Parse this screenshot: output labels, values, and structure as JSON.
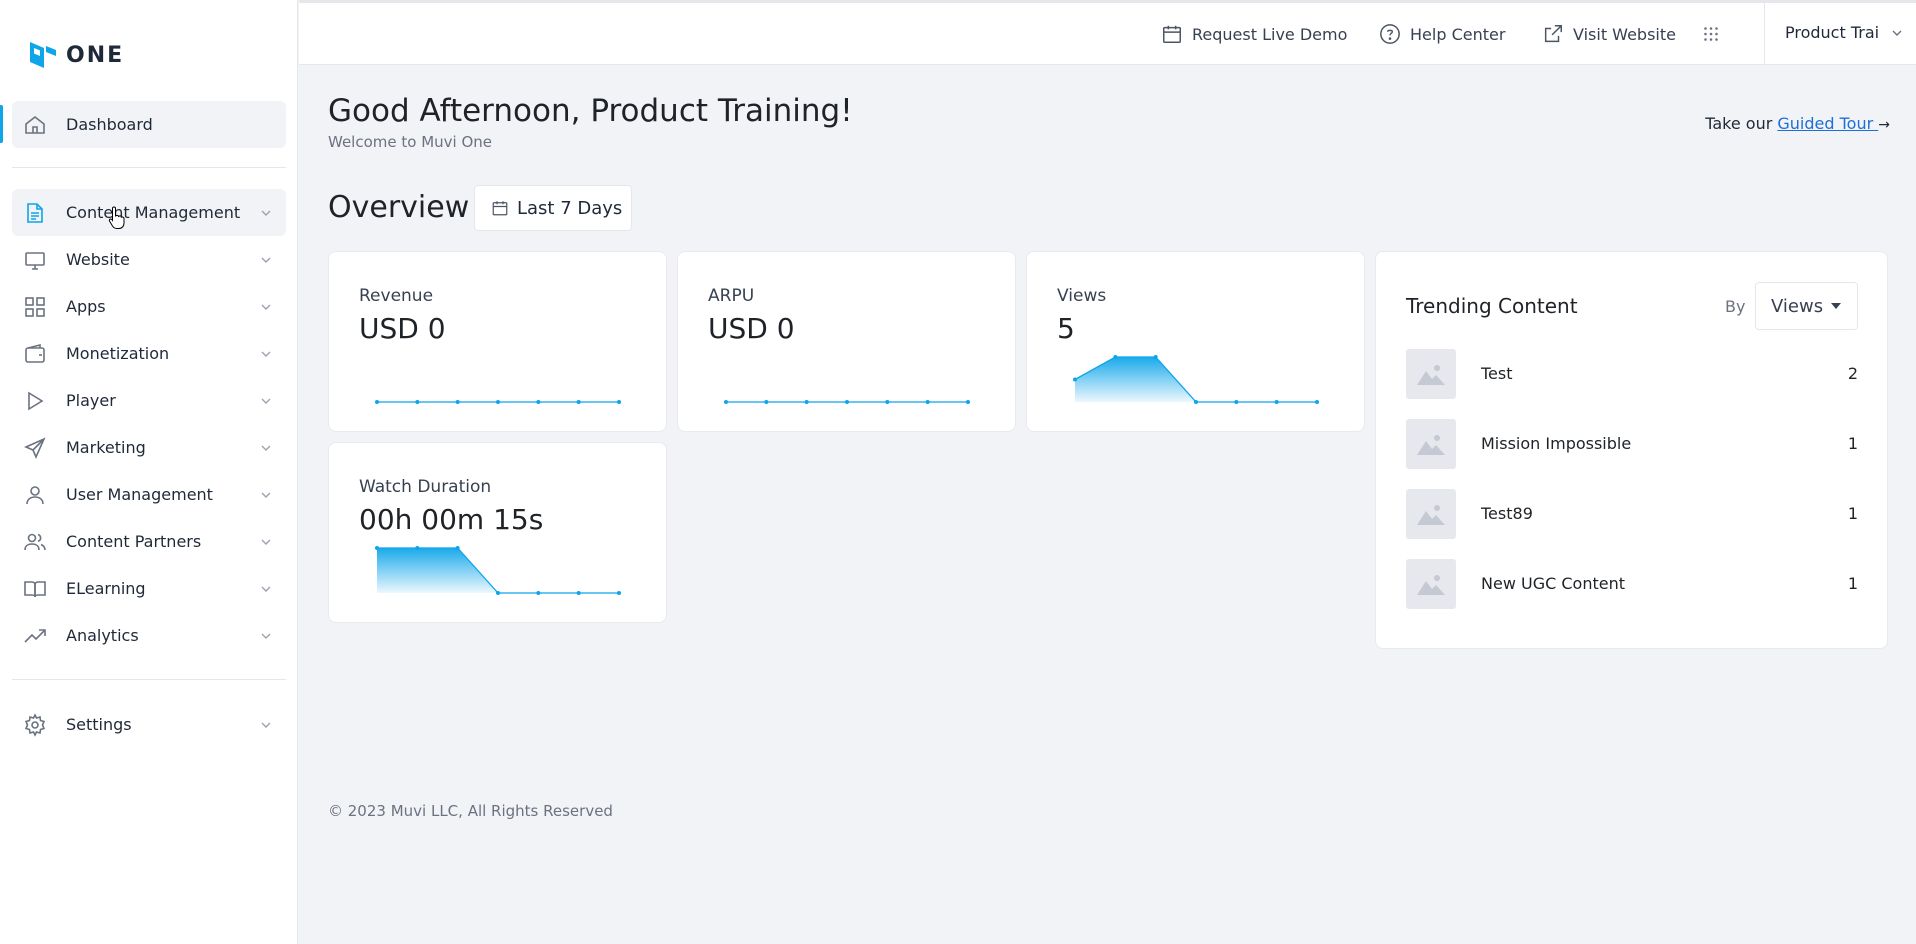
{
  "app": {
    "logo_text": "ONE",
    "brand_color": "#0ea5e9"
  },
  "sidebar": {
    "dashboard": {
      "label": "Dashboard",
      "icon": "home-icon"
    },
    "items": [
      {
        "label": "Content Management",
        "icon": "document-icon"
      },
      {
        "label": "Website",
        "icon": "monitor-icon"
      },
      {
        "label": "Apps",
        "icon": "grid-icon"
      },
      {
        "label": "Monetization",
        "icon": "wallet-icon"
      },
      {
        "label": "Player",
        "icon": "play-icon"
      },
      {
        "label": "Marketing",
        "icon": "send-icon"
      },
      {
        "label": "User Management",
        "icon": "user-icon"
      },
      {
        "label": "Content Partners",
        "icon": "users-icon"
      },
      {
        "label": "ELearning",
        "icon": "book-icon"
      },
      {
        "label": "Analytics",
        "icon": "trending-up-icon"
      }
    ],
    "settings": {
      "label": "Settings",
      "icon": "gear-icon"
    }
  },
  "topbar": {
    "request_demo": "Request Live Demo",
    "help_center": "Help Center",
    "visit_website": "Visit Website",
    "account": "Product Trai"
  },
  "header": {
    "greeting": "Good Afternoon, Product Training!",
    "welcome": "Welcome to Muvi One",
    "tour_prefix": "Take our ",
    "tour_link": "Guided Tour "
  },
  "overview": {
    "title": "Overview",
    "range": "Last 7 Days",
    "cards": [
      {
        "title": "Revenue",
        "value": "USD 0",
        "series": [
          0,
          0,
          0,
          0,
          0,
          0,
          0
        ]
      },
      {
        "title": "ARPU",
        "value": "USD 0",
        "series": [
          0,
          0,
          0,
          0,
          0,
          0,
          0
        ]
      },
      {
        "title": "Views",
        "value": "5",
        "series": [
          1,
          2,
          2,
          0,
          0,
          0,
          0
        ]
      },
      {
        "title": "Watch Duration",
        "value": "00h 00m 15s",
        "series": [
          5,
          5,
          5,
          0,
          0,
          0,
          0
        ]
      }
    ]
  },
  "trending": {
    "title": "Trending Content",
    "by_label": "By",
    "metric": "Views",
    "items": [
      {
        "name": "Test",
        "count": "2"
      },
      {
        "name": "Mission Impossible",
        "count": "1"
      },
      {
        "name": "Test89",
        "count": "1"
      },
      {
        "name": "New UGC Content",
        "count": "1"
      }
    ]
  },
  "footer": {
    "copyright": "© 2023 Muvi LLC, All Rights Reserved"
  }
}
